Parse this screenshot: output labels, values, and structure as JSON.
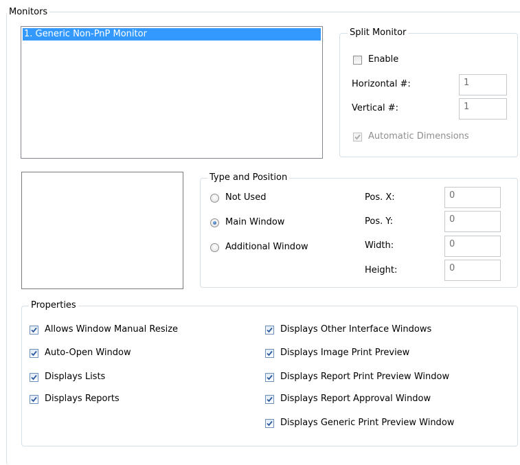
{
  "monitors": {
    "label": "Monitors",
    "items": [
      "1. Generic Non-PnP Monitor"
    ],
    "selected_index": 0
  },
  "split_monitor": {
    "label": "Split Monitor",
    "enable_label": "Enable",
    "enable_checked": false,
    "horizontal_label": "Horizontal #:",
    "horizontal_value": "1",
    "vertical_label": "Vertical #:",
    "vertical_value": "1",
    "auto_dim_label": "Automatic Dimensions",
    "auto_dim_checked": true
  },
  "type_position": {
    "label": "Type and Position",
    "options": [
      {
        "label": "Not Used",
        "selected": false
      },
      {
        "label": "Main Window",
        "selected": true
      },
      {
        "label": "Additional Window",
        "selected": false
      }
    ],
    "pos_x_label": "Pos. X:",
    "pos_x_value": "0",
    "pos_y_label": "Pos. Y:",
    "pos_y_value": "0",
    "width_label": "Width:",
    "width_value": "0",
    "height_label": "Height:",
    "height_value": "0"
  },
  "properties": {
    "label": "Properties",
    "left": [
      {
        "label": "Allows Window Manual Resize",
        "checked": true
      },
      {
        "label": "Auto-Open Window",
        "checked": true
      },
      {
        "label": "Displays Lists",
        "checked": true
      },
      {
        "label": "Displays Reports",
        "checked": true
      }
    ],
    "right": [
      {
        "label": "Displays Other Interface Windows",
        "checked": true
      },
      {
        "label": "Displays Image Print Preview",
        "checked": true
      },
      {
        "label": "Displays Report Print Preview Window",
        "checked": true
      },
      {
        "label": "Displays Report Approval Window",
        "checked": true
      },
      {
        "label": "Displays Generic Print Preview Window",
        "checked": true
      }
    ]
  },
  "colors": {
    "selection": "#3399ff",
    "group_border": "#d5dfe5",
    "check_blue": "#2c5aa0",
    "check_gray": "#a8a8a8"
  }
}
